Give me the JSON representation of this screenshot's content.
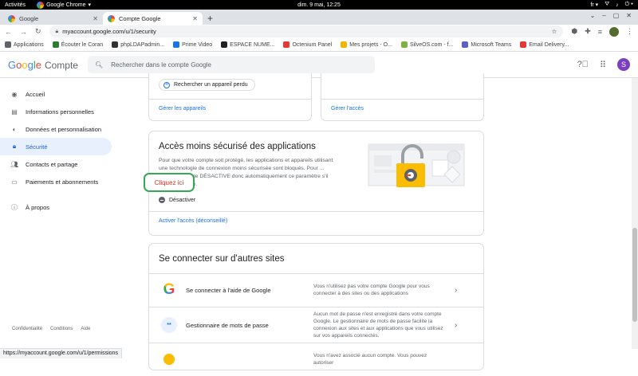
{
  "gnome": {
    "activities": "Activités",
    "app": "Google Chrome",
    "app_arrow": "▾",
    "clock": "dim.  9 mai, 12:25",
    "lang": "fr",
    "lang_arrow": "▾"
  },
  "tabs": [
    {
      "label": "Google"
    },
    {
      "label": "Compte Google"
    }
  ],
  "address": {
    "url": "myaccount.google.com/u/1/security"
  },
  "bookmarks": [
    {
      "label": "Applications",
      "color": "#5f6368"
    },
    {
      "label": "Écouter le Coran",
      "color": "#2e7d32"
    },
    {
      "label": "phpLDAPadmin...",
      "color": "#333333"
    },
    {
      "label": "Prime Video",
      "color": "#1a73e8"
    },
    {
      "label": "ESPACE NUME...",
      "color": "#202124"
    },
    {
      "label": "Octenium Panel",
      "color": "#e53935"
    },
    {
      "label": "Mes projets - O...",
      "color": "#f4b400"
    },
    {
      "label": "SilveOS.com - f...",
      "color": "#7cb342"
    },
    {
      "label": "Microsoft Teams",
      "color": "#5b5fc7"
    },
    {
      "label": "Email Delivery...",
      "color": "#e53935"
    }
  ],
  "header": {
    "logo_letters": [
      {
        "ch": "G",
        "color": "#4285f4"
      },
      {
        "ch": "o",
        "color": "#ea4335"
      },
      {
        "ch": "o",
        "color": "#fbbc05"
      },
      {
        "ch": "g",
        "color": "#4285f4"
      },
      {
        "ch": "l",
        "color": "#34a853"
      },
      {
        "ch": "e",
        "color": "#ea4335"
      }
    ],
    "product": "Compte",
    "search_placeholder": "Rechercher dans le compte Google",
    "avatar_letter": "S"
  },
  "sidebar": {
    "items": [
      {
        "label": "Accueil",
        "icon": "person-circle-icon"
      },
      {
        "label": "Informations personnelles",
        "icon": "id-card-icon"
      },
      {
        "label": "Données et personnalisation",
        "icon": "toggle-icon"
      },
      {
        "label": "Sécurité",
        "icon": "lock-icon"
      },
      {
        "label": "Contacts et partage",
        "icon": "people-icon"
      },
      {
        "label": "Paiements et abonnements",
        "icon": "credit-card-icon"
      },
      {
        "label": "À propos",
        "icon": "info-icon"
      }
    ],
    "footer": [
      "Confidentialité",
      "Conditions",
      "Aide"
    ]
  },
  "devices_card": {
    "find_device": "Rechercher un appareil perdu",
    "manage_devices": "Gérer les appareils"
  },
  "access_card": {
    "manage_access": "Gérer l'accès"
  },
  "less_secure": {
    "title": "Accès moins sécurisé des applications",
    "description": "Pour que votre compte soit protégé, les applications et appareils utilisant une technologie de connexion moins sécurisée sont bloqués. Pour ... sécurité, Google DÉSACTIVE donc automatiquement ce paramètre s'il n'est pas utilisé.",
    "status": "Désactiver",
    "enable_link": "Activer l'accès (déconseillé)"
  },
  "annotation": {
    "text": "Cliquez ici"
  },
  "other_sites": {
    "title": "Se connecter sur d'autres sites",
    "rows": [
      {
        "label": "Se connecter à l'aide de Google",
        "desc": "Vous n'utilisez pas votre compte Google pour vous connecter à des sites ou des applications"
      },
      {
        "label": "Gestionnaire de mots de passe",
        "desc": "Aucun mot de passe n'est enregistré dans votre compte Google. Le gestionnaire de mots de passe facilite la connexion aux sites et aux applications que vous utilisez sur vos appareils connectés."
      },
      {
        "label": "",
        "desc": "Vous n'avez associé aucun compte. Vous pouvez autoriser"
      }
    ]
  },
  "status_url": "https://myaccount.google.com/u/1/permissions"
}
